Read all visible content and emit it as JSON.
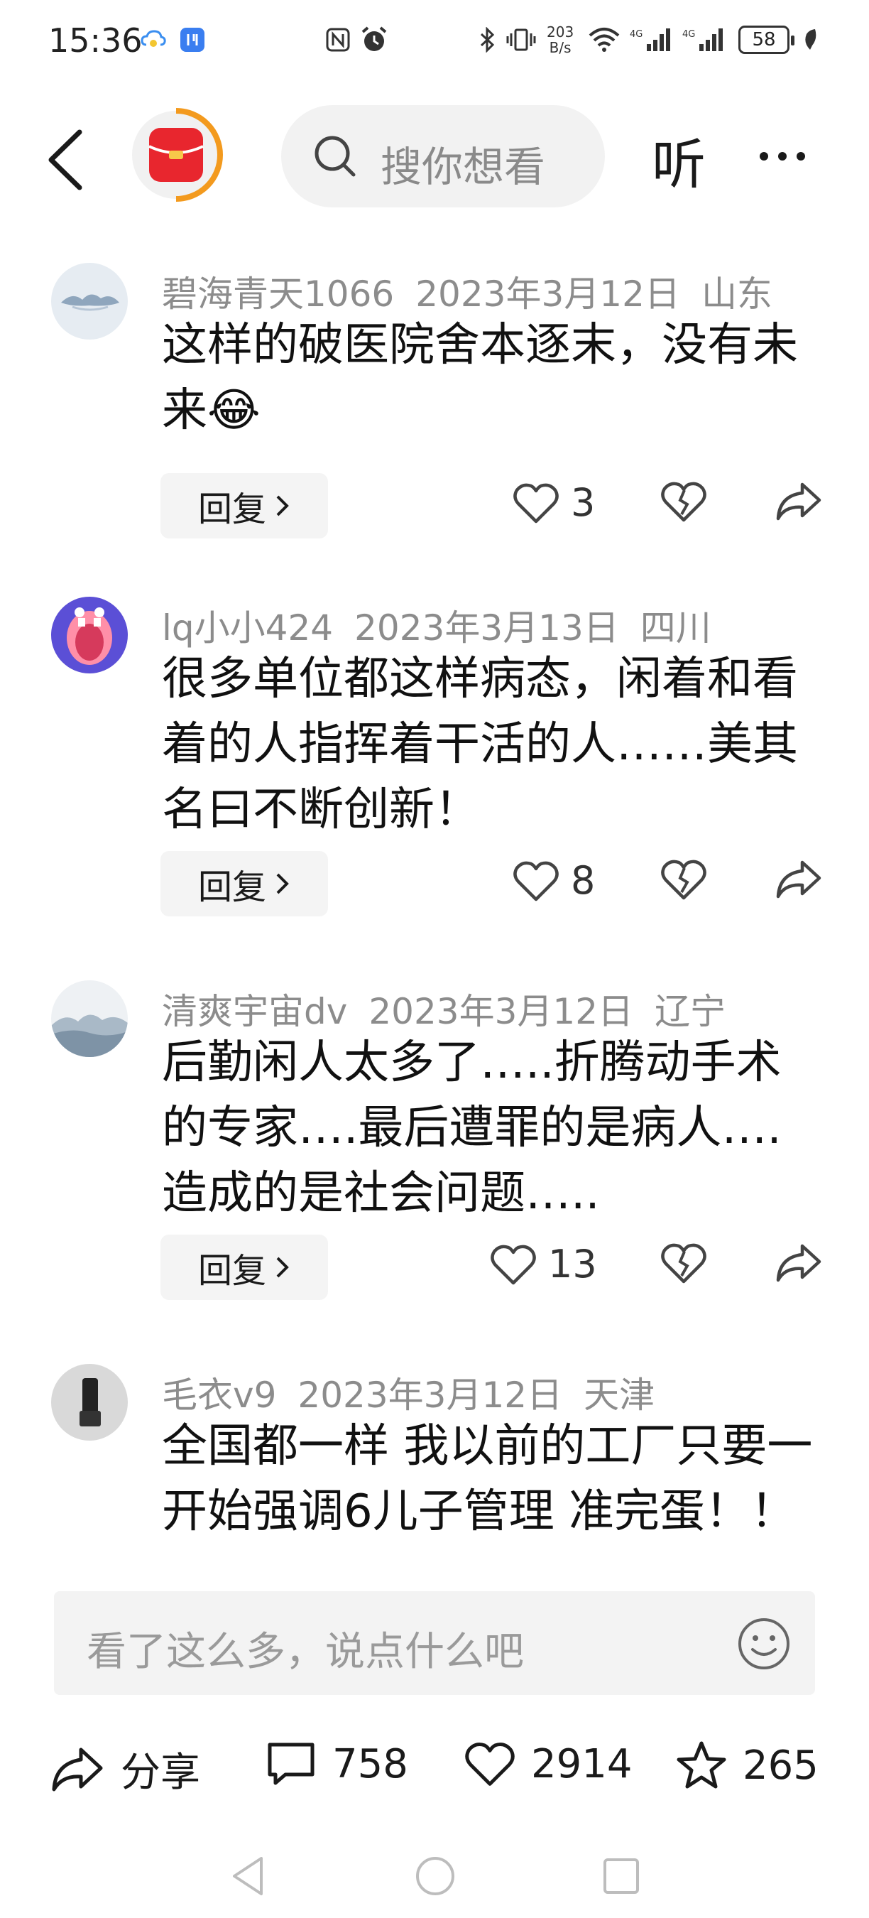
{
  "status": {
    "time": "15:36",
    "net_speed_top": "203",
    "net_speed_bottom": "B/s",
    "battery": "58"
  },
  "header": {
    "search_placeholder": "搜你想看",
    "listen_label": "听"
  },
  "comments": [
    {
      "user": "碧海青天1066",
      "date": "2023年3月12日",
      "location": "山东",
      "text": "这样的破医院舍本逐末，没有未来😂",
      "reply_label": "回复",
      "likes": "3"
    },
    {
      "user": "lq小小424",
      "date": "2023年3月13日",
      "location": "四川",
      "text": "很多单位都这样病态，闲着和看着的人指挥着干活的人……美其名曰不断创新！",
      "reply_label": "回复",
      "likes": "8"
    },
    {
      "user": "清爽宇宙dv",
      "date": "2023年3月12日",
      "location": "辽宁",
      "text": "后勤闲人太多了…..折腾动手术的专家….最后遭罪的是病人….造成的是社会问题…..",
      "reply_label": "回复",
      "likes": "13"
    },
    {
      "user": "毛衣v9",
      "date": "2023年3月12日",
      "location": "天津",
      "text": "全国都一样 我以前的工厂只要一开始强调6儿子管理 准完蛋！！"
    }
  ],
  "input": {
    "placeholder": "看了这么多，说点什么吧"
  },
  "toolbar": {
    "share_label": "分享",
    "comment_count": "758",
    "like_count": "2914",
    "favorite_count": "265"
  },
  "colors": {
    "logo_red": "#e8262e",
    "logo_ring": "#f39a1e",
    "muted_text": "#8c8c8c",
    "button_bg": "#f4f4f4"
  }
}
